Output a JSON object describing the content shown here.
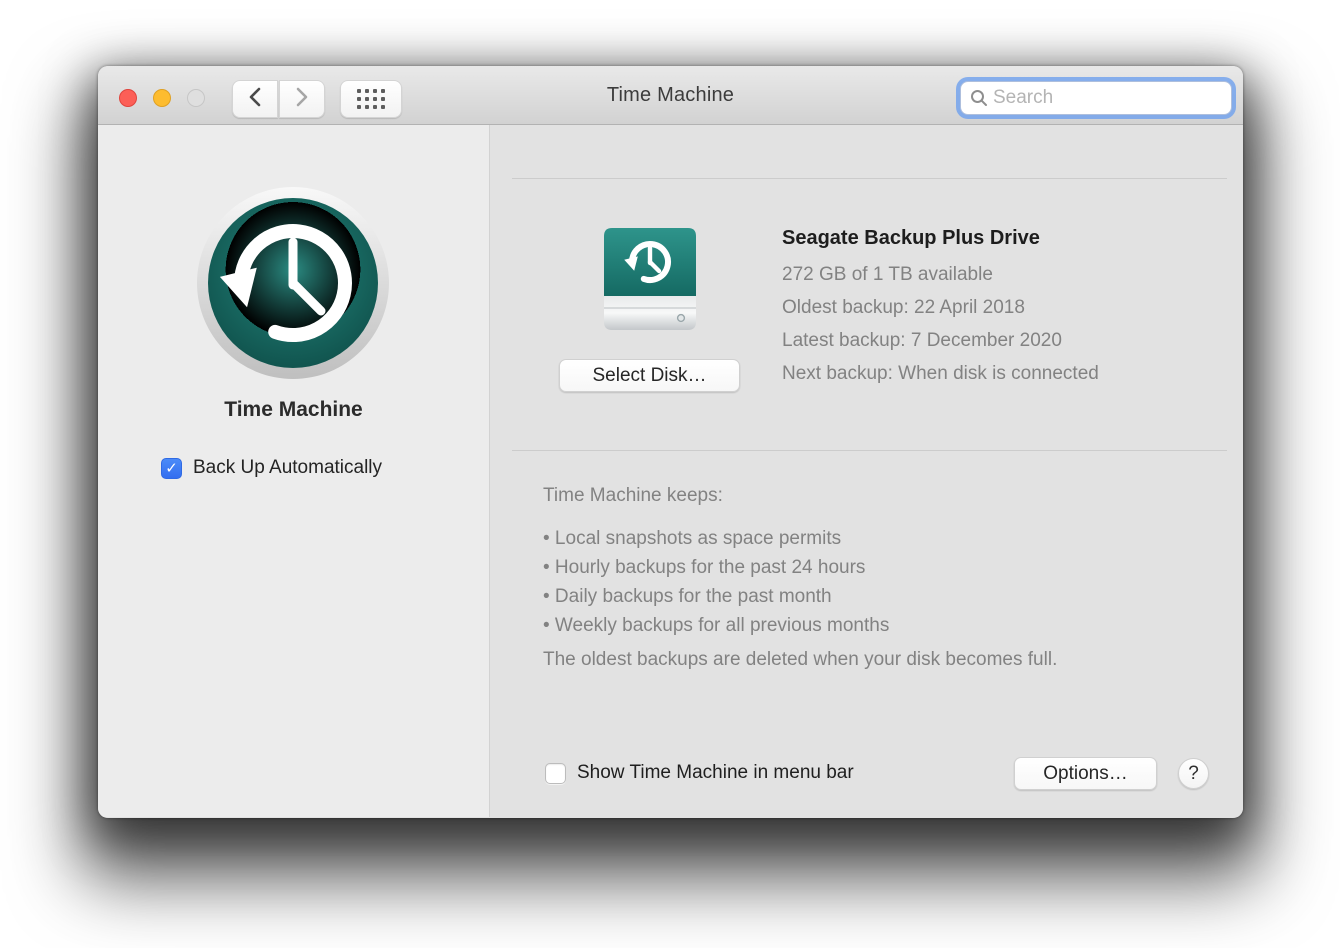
{
  "window": {
    "title": "Time Machine"
  },
  "toolbar": {
    "search_placeholder": "Search"
  },
  "sidebar": {
    "app_title": "Time Machine",
    "backup_automatically_label": "Back Up Automatically",
    "backup_automatically_checked": true,
    "checkmark_glyph": "✓"
  },
  "disk": {
    "name": "Seagate Backup Plus Drive",
    "available": "272 GB of 1 TB available",
    "oldest": "Oldest backup: 22 April 2018",
    "latest": "Latest backup: 7 December 2020",
    "next": "Next backup: When disk is connected",
    "select_disk_label": "Select Disk…"
  },
  "keeps": {
    "heading": "Time Machine keeps:",
    "items": [
      "• Local snapshots as space permits",
      "• Hourly backups for the past 24 hours",
      "• Daily backups for the past month",
      "• Weekly backups for all previous months"
    ],
    "footnote": "The oldest backups are deleted when your disk becomes full."
  },
  "footer": {
    "menubar_label": "Show Time Machine in menu bar",
    "menubar_checked": false,
    "options_label": "Options…",
    "help_label": "?"
  },
  "colors": {
    "accent_blue": "#3a7cf6",
    "teal_dark": "#0c4843",
    "teal_light": "#2b8c83",
    "traffic_red": "#fc5f57",
    "traffic_yellow": "#fdbc2f"
  }
}
